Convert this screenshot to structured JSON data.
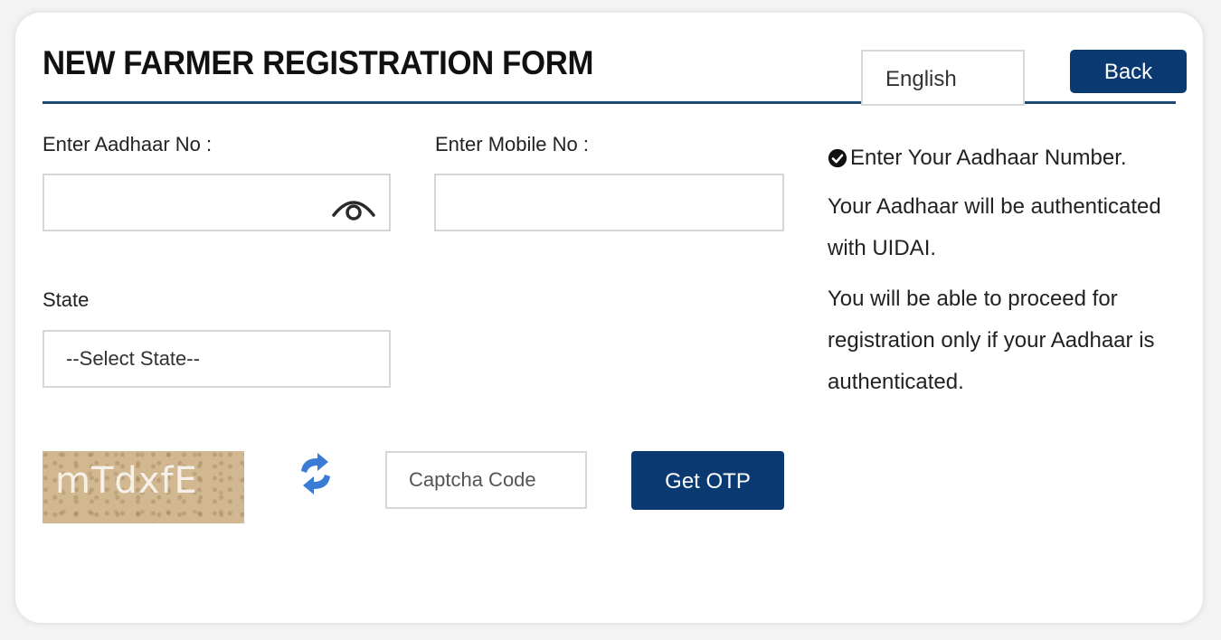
{
  "header": {
    "title": "NEW FARMER REGISTRATION FORM",
    "language": "English",
    "back_label": "Back"
  },
  "form": {
    "aadhaar_label": "Enter Aadhaar No :",
    "aadhaar_value": "",
    "mobile_label": "Enter Mobile No :",
    "mobile_value": "",
    "state_label": "State",
    "state_selected": "--Select State--",
    "captcha_text": "mTdxfE",
    "captcha_placeholder": "Captcha Code",
    "otp_label": "Get OTP"
  },
  "info": {
    "heading": "Enter Your Aadhaar Number.",
    "para1": "Your Aadhaar will be authenticated with UIDAI.",
    "para2": "You will be able to proceed for registration only if your Aadhaar is authenticated."
  },
  "icons": {
    "eye": "eye-icon",
    "refresh": "refresh-icon",
    "check": "check-circle-icon"
  },
  "colors": {
    "primary": "#0b3a73",
    "rule": "#1e4a73",
    "refresh": "#3a7bd5",
    "captcha_bg": "#d2b890"
  }
}
